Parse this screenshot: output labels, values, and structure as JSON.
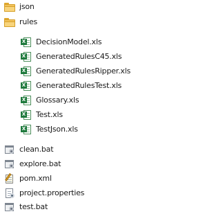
{
  "tree": {
    "items": [
      {
        "label": "json",
        "icon": "folder-icon"
      },
      {
        "label": "rules",
        "icon": "folder-icon"
      },
      {
        "label": "DecisionModel.xls",
        "icon": "excel-file-icon"
      },
      {
        "label": "GeneratedRulesC45.xls",
        "icon": "excel-file-icon"
      },
      {
        "label": "GeneratedRulesRipper.xls",
        "icon": "excel-file-icon"
      },
      {
        "label": "GeneratedRulesTest.xls",
        "icon": "excel-file-icon"
      },
      {
        "label": "Glossary.xls",
        "icon": "excel-file-icon"
      },
      {
        "label": "Test.xls",
        "icon": "excel-file-icon"
      },
      {
        "label": "TestJson.xls",
        "icon": "excel-file-icon"
      },
      {
        "label": "clean.bat",
        "icon": "batch-file-icon"
      },
      {
        "label": "explore.bat",
        "icon": "batch-file-icon"
      },
      {
        "label": "pom.xml",
        "icon": "xml-file-icon"
      },
      {
        "label": "project.properties",
        "icon": "properties-file-icon"
      },
      {
        "label": "test.bat",
        "icon": "batch-file-icon"
      }
    ],
    "excel_badge": "X"
  },
  "colors": {
    "folder": "#f2c25a",
    "excel": "#1f7a3d",
    "text": "#1a1a1a",
    "background": "#ffffff"
  }
}
